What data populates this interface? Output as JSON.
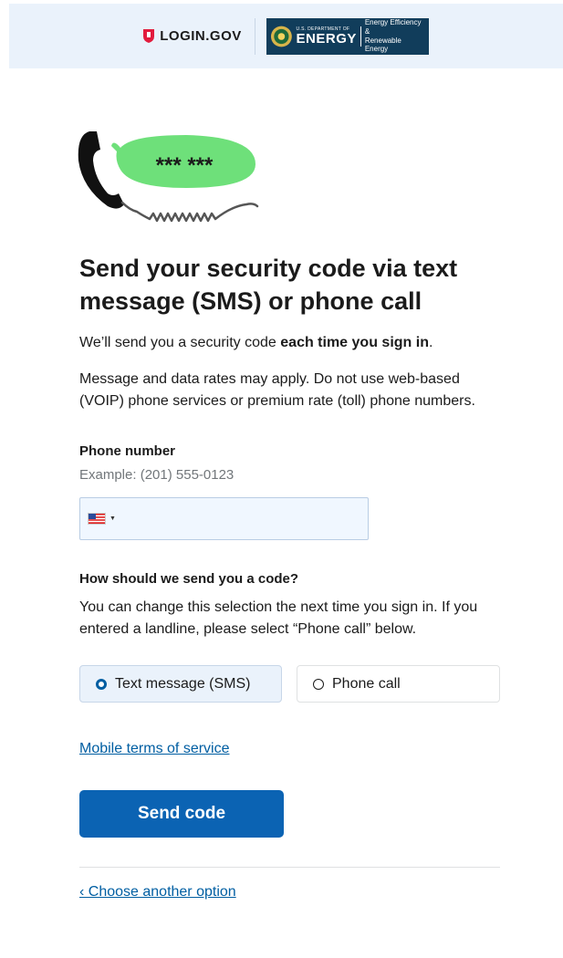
{
  "header": {
    "logo_text": "LOGIN.GOV",
    "partner_small": "U.S. DEPARTMENT OF",
    "partner_big": "ENERGY",
    "partner_office_line1": "Energy Efficiency &",
    "partner_office_line2": "Renewable Energy"
  },
  "illustration": {
    "code_text": "*** ***",
    "icon": "phone-with-speech-bubble-icon"
  },
  "main": {
    "title": "Send your security code via text message (SMS) or phone call",
    "intro_prefix": "We’ll send you a security code ",
    "intro_bold": "each time you sign in",
    "intro_suffix": ".",
    "rates_text": "Message and data rates may apply. Do not use web-based (VOIP) phone services or premium rate (toll) phone numbers.",
    "phone_label": "Phone number",
    "phone_hint": "Example: (201) 555-0123",
    "phone_value": "",
    "delivery_question": "How should we send you a code?",
    "delivery_desc": "You can change this selection the next time you sign in. If you entered a landline, please select “Phone call” below.",
    "options": [
      {
        "label": "Text message (SMS)",
        "selected": true
      },
      {
        "label": "Phone call",
        "selected": false
      }
    ],
    "terms_link": "Mobile terms of service",
    "send_button": "Send code",
    "back_link": "‹ Choose another option"
  },
  "colors": {
    "primary": "#0b63b3",
    "link": "#005ea2",
    "header_bg": "#eaf2fb",
    "bubble": "#6ee07a",
    "partner_bg": "#113d5b"
  }
}
